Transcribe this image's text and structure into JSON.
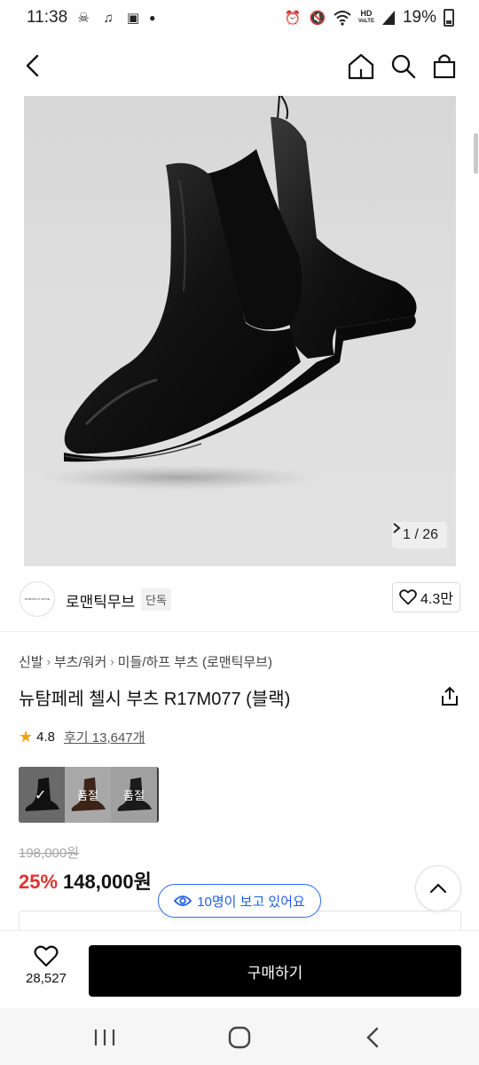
{
  "status_bar": {
    "time": "11:38",
    "battery": "19%",
    "hd_label_top": "HD",
    "hd_label_bottom": "VoLTE"
  },
  "header": {
    "icons": [
      "back-icon",
      "home-icon",
      "search-icon",
      "shopping-bag-icon"
    ]
  },
  "gallery": {
    "pager": "1 / 26"
  },
  "brand": {
    "logo_text": "ROMANTIC MOVE",
    "name": "로맨틱무브",
    "tag": "단독",
    "likes": "4.3만"
  },
  "breadcrumb": [
    "신발",
    "부츠/워커",
    "미들/하프 부츠 (로맨틱무브)"
  ],
  "product": {
    "title": "뉴탐페레 첼시 부츠 R17M077 (블랙)",
    "rating": "4.8",
    "reviews": "후기 13,647개",
    "options": [
      {
        "label": "",
        "selected": true
      },
      {
        "label": "품절",
        "selected": false
      },
      {
        "label": "품절",
        "selected": false
      }
    ],
    "original_price": "198,000원",
    "discount": "25%",
    "price": "148,000원"
  },
  "viewers": "10명이 보고 있어요",
  "purchase_bar": {
    "wish_count": "28,527",
    "buy_label": "구매하기"
  },
  "colors": {
    "accent_blue": "#1f5fe0",
    "discount_red": "#e03232",
    "buy_button": "#000000"
  }
}
